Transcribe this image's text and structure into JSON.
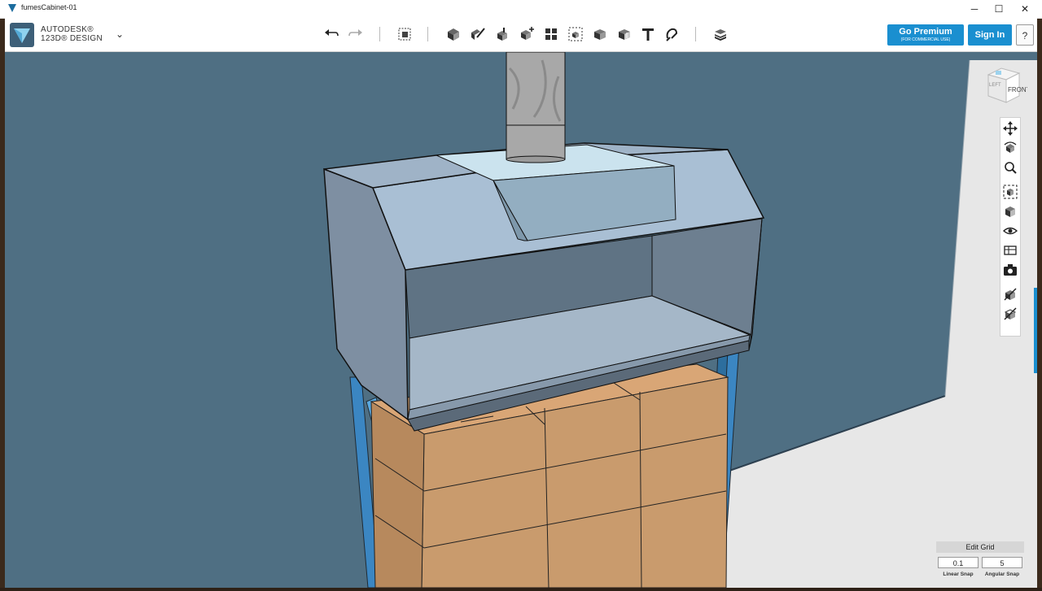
{
  "window": {
    "title": "fumesCabinet-01",
    "minimize": "─",
    "maximize": "☐",
    "close": "✕"
  },
  "toolbar": {
    "brand_line1": "AUTODESK®",
    "brand_line2": "123D® DESIGN",
    "menu_chevron": "⌄",
    "tools": [
      {
        "name": "undo-icon"
      },
      {
        "name": "redo-icon"
      },
      {
        "name": "transform-icon"
      },
      {
        "name": "primitives-icon"
      },
      {
        "name": "sketch-icon"
      },
      {
        "name": "construct-icon"
      },
      {
        "name": "modify-icon"
      },
      {
        "name": "pattern-icon"
      },
      {
        "name": "group-icon"
      },
      {
        "name": "combine-icon"
      },
      {
        "name": "measure-icon"
      },
      {
        "name": "text-icon"
      },
      {
        "name": "snap-icon"
      },
      {
        "name": "material-icon"
      }
    ],
    "go_premium": "Go Premium",
    "go_premium_sub": "(FOR COMMERCIAL USE)",
    "sign_in": "Sign In",
    "help": "?"
  },
  "viewcube": {
    "front_label": "FRONT",
    "left_label": "LEFT"
  },
  "nav_tools": [
    {
      "name": "pan-icon"
    },
    {
      "name": "orbit-icon"
    },
    {
      "name": "zoom-icon"
    },
    {
      "name": "fit-icon"
    },
    {
      "name": "view-cube-icon"
    },
    {
      "name": "visibility-icon"
    },
    {
      "name": "materials-outline-icon"
    },
    {
      "name": "camera-icon"
    },
    {
      "name": "hide-icon"
    },
    {
      "name": "show-hidden-icon"
    }
  ],
  "grid": {
    "edit_grid": "Edit Grid",
    "linear_snap_value": "0.1",
    "linear_snap_label": "Linear Snap",
    "angular_snap_value": "5",
    "angular_snap_label": "Angular Snap"
  },
  "colors": {
    "accent": "#1a8fd0",
    "viewport_bg": "#4d6d81",
    "cabinet": "#a9bfd4",
    "box": "#c99b6d",
    "frame": "#3c86c0"
  }
}
